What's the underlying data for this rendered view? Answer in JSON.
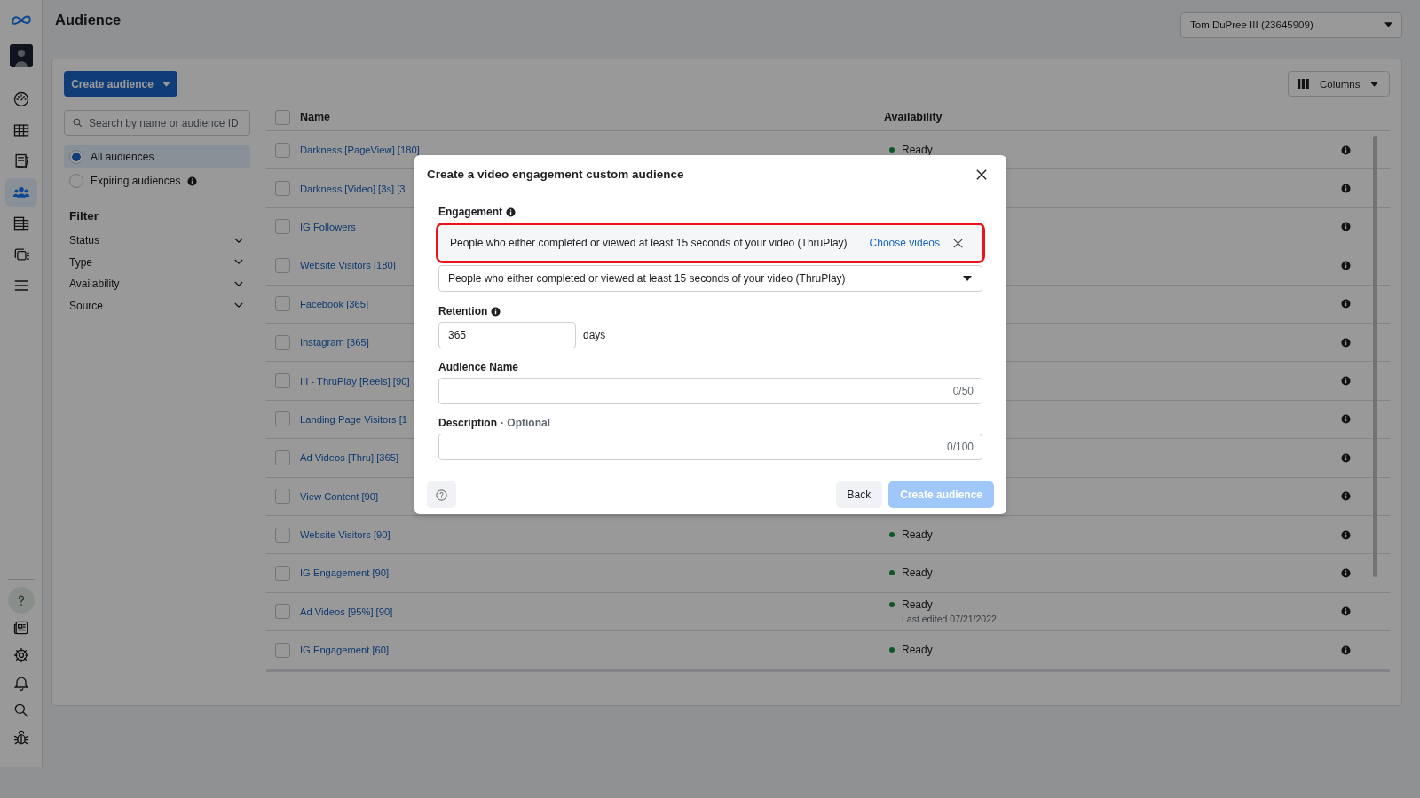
{
  "rail": {
    "top": [
      {
        "selected": false
      },
      {
        "selected": false
      },
      {
        "selected": false
      },
      {
        "selected": true
      },
      {
        "selected": false
      },
      {
        "selected": false
      },
      {
        "selected": false
      }
    ],
    "bottom": [
      {
        "selected": true
      },
      {
        "selected": false
      },
      {
        "selected": false
      },
      {
        "selected": false
      },
      {
        "selected": false
      },
      {
        "selected": false
      }
    ]
  },
  "header": {
    "title": "Audience",
    "account": "Tom DuPree III (23645909)"
  },
  "toolbar": {
    "create_button": "Create audience",
    "columns_button": "Columns"
  },
  "search": {
    "placeholder": "Search by name or audience ID"
  },
  "audience_scope": [
    {
      "label": "All audiences",
      "selected": true,
      "info": false
    },
    {
      "label": "Expiring audiences",
      "selected": false,
      "info": true
    }
  ],
  "filter": {
    "title": "Filter",
    "items": [
      "Status",
      "Type",
      "Availability",
      "Source"
    ]
  },
  "table": {
    "columns": [
      "Name",
      "Availability"
    ],
    "all_checked": false,
    "rows": [
      {
        "name": "Darkness [PageView] [180]",
        "availability": "Ready",
        "checked": false
      },
      {
        "name": "Darkness [Video] [3s] [3",
        "checked": false
      },
      {
        "name": "IG Followers",
        "checked": false
      },
      {
        "name": "Website Visitors [180]",
        "checked": false
      },
      {
        "name": "Facebook [365]",
        "checked": false
      },
      {
        "name": "Instagram [365]",
        "checked": false
      },
      {
        "name": "III - ThruPlay [Reels] [90]",
        "checked": false
      },
      {
        "name": "Landing Page Visitors [1",
        "checked": false
      },
      {
        "name": "Ad Videos [Thru] [365]",
        "checked": false
      },
      {
        "name": "View Content [90]",
        "checked": false
      },
      {
        "name": "Website Visitors [90]",
        "availability": "Ready",
        "checked": false
      },
      {
        "name": "IG Engagement [90]",
        "availability": "Ready",
        "checked": false
      },
      {
        "name": "Ad Videos [95%] [90]",
        "availability": "Ready",
        "note": "Last edited 07/21/2022",
        "checked": false
      },
      {
        "name": "IG Engagement [60]",
        "availability": "Ready",
        "checked": false
      }
    ]
  },
  "modal": {
    "title": "Create a video engagement custom audience",
    "engagement": {
      "label": "Engagement",
      "chosen": "People who either completed or viewed at least 15 seconds of your video (ThruPlay)",
      "link": "Choose videos",
      "highlighted": true,
      "select_value": "People who either completed or viewed at least 15 seconds of your video (ThruPlay)"
    },
    "retention": {
      "label": "Retention",
      "value": "365",
      "unit": "days"
    },
    "audience_name": {
      "label": "Audience Name",
      "counter": "0/50"
    },
    "description": {
      "label": "Description",
      "optional": "· Optional",
      "counter": "0/100"
    },
    "buttons": {
      "back": "Back",
      "create": "Create audience",
      "create_disabled": true
    }
  }
}
